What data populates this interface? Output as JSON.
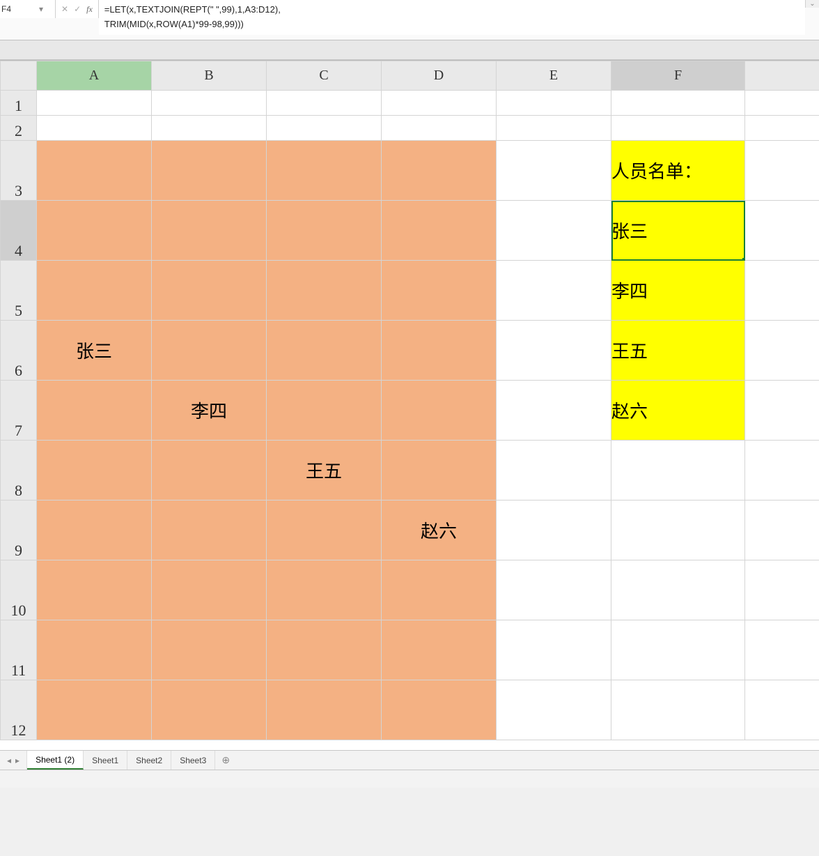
{
  "namebox": {
    "value": "F4"
  },
  "formula": {
    "line1": "=LET(x,TEXTJOIN(REPT(\" \",99),1,A3:D12),",
    "line2": "TRIM(MID(x,ROW(A1)*99-98,99)))"
  },
  "columns": [
    "A",
    "B",
    "C",
    "D",
    "E",
    "F"
  ],
  "rows": [
    "1",
    "2",
    "3",
    "4",
    "5",
    "6",
    "7",
    "8",
    "9",
    "10",
    "11",
    "12"
  ],
  "activeCell": {
    "col": "F",
    "row": "4"
  },
  "orangeData": {
    "A6": "张三",
    "B7": "李四",
    "C8": "王五",
    "D9": "赵六"
  },
  "yellowData": {
    "F3": "人员名单：",
    "F4": "张三",
    "F5": "李四",
    "F6": "王五",
    "F7": "赵六"
  },
  "tabs": {
    "items": [
      "Sheet1 (2)",
      "Sheet1",
      "Sheet2",
      "Sheet3"
    ],
    "activeIndex": 0
  },
  "status": ""
}
